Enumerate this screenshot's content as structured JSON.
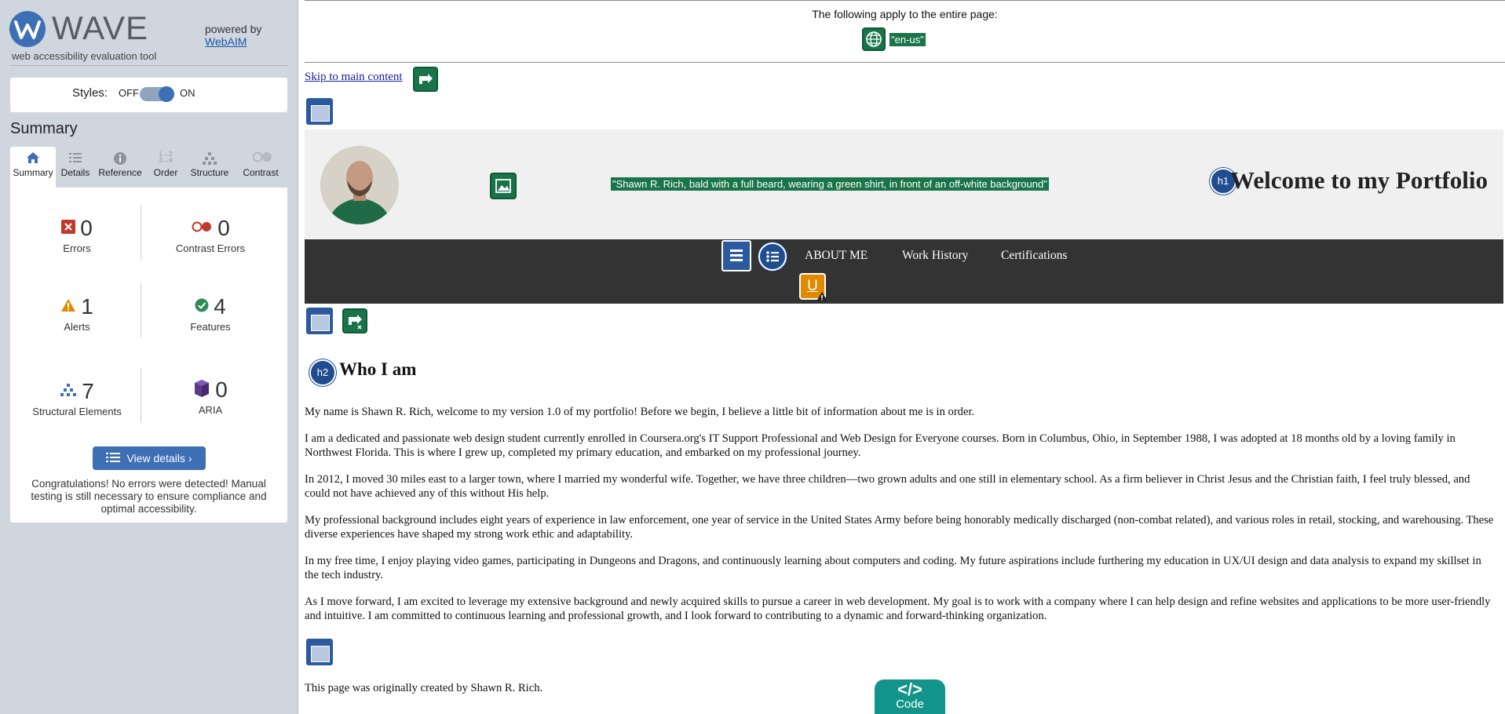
{
  "sidebar": {
    "title": "WAVE",
    "subtitle": "web accessibility evaluation tool",
    "powered_by": "powered by",
    "webaim_link": "WebAIM",
    "styles_label": "Styles:",
    "styles_off": "OFF",
    "styles_on": "ON",
    "summary_heading": "Summary",
    "tabs": [
      {
        "label": "Summary",
        "icon": "home-icon"
      },
      {
        "label": "Details",
        "icon": "list-icon"
      },
      {
        "label": "Reference",
        "icon": "info-icon"
      },
      {
        "label": "Order",
        "icon": "order-icon"
      },
      {
        "label": "Structure",
        "icon": "structure-icon"
      },
      {
        "label": "Contrast",
        "icon": "contrast-icon"
      }
    ],
    "stats": {
      "errors": {
        "value": "0",
        "label": "Errors"
      },
      "contrast_errors": {
        "value": "0",
        "label": "Contrast Errors"
      },
      "alerts": {
        "value": "1",
        "label": "Alerts"
      },
      "features": {
        "value": "4",
        "label": "Features"
      },
      "structural": {
        "value": "7",
        "label": "Structural Elements"
      },
      "aria": {
        "value": "0",
        "label": "ARIA"
      }
    },
    "view_details": "View details ›",
    "congrats": "Congratulations! No errors were detected! Manual testing is still necessary to ensure compliance and optimal accessibility."
  },
  "page": {
    "lang_notice": "The following apply to the entire page:",
    "lang_value": "\"en-us\"",
    "skip_link": "Skip to main content",
    "image_alt": "\"Shawn R. Rich, bald with a full beard, wearing a green shirt, in front of an off-white background\"",
    "h1_badge": "h1",
    "h1_text": "Welcome to my Portfolio",
    "nav": [
      "ABOUT ME",
      "Work History",
      "Certifications"
    ],
    "alert_badge": "U",
    "h2_badge": "h2",
    "h2_text": "Who I am",
    "paragraphs": [
      "My name is Shawn R. Rich, welcome to my version 1.0 of my portfolio! Before we begin, I believe a little bit of information about me is in order.",
      "I am a dedicated and passionate web design student currently enrolled in Coursera.org's IT Support Professional and Web Design for Everyone courses. Born in Columbus, Ohio, in September 1988, I was adopted at 18 months old by a loving family in Northwest Florida. This is where I grew up, completed my primary education, and embarked on my professional journey.",
      "In 2012, I moved 30 miles east to a larger town, where I married my wonderful wife. Together, we have three children—two grown adults and one still in elementary school. As a firm believer in Christ Jesus and the Christian faith, I feel truly blessed, and could not have achieved any of this without His help.",
      "My professional background includes eight years of experience in law enforcement, one year of service in the United States Army before being honorably medically discharged (non-combat related), and various roles in retail, stocking, and warehousing. These diverse experiences have shaped my strong work ethic and adaptability.",
      "In my free time, I enjoy playing video games, participating in Dungeons and Dragons, and continuously learning about computers and coding. My future aspirations include furthering my education in UX/UI design and data analysis to expand my skillset in the tech industry.",
      "As I move forward, I am excited to leverage my extensive background and newly acquired skills to pursue a career in web development. My goal is to work with a company where I can help design and refine websites and applications to be more user-friendly and intuitive. I am committed to continuous learning and professional growth, and I look forward to contributing to a dynamic and forward-thinking organization."
    ],
    "footer": "This page was originally created by Shawn R. Rich.",
    "code_label": "Code",
    "code_symbol": "</>"
  },
  "colors": {
    "wave_blue": "#3d6fb4",
    "feature_green": "#19744a",
    "error_red": "#c0392b",
    "alert_orange": "#e08a00",
    "aria_purple": "#5b3a8e",
    "nav_dark": "#333333",
    "code_teal": "#13948a"
  }
}
